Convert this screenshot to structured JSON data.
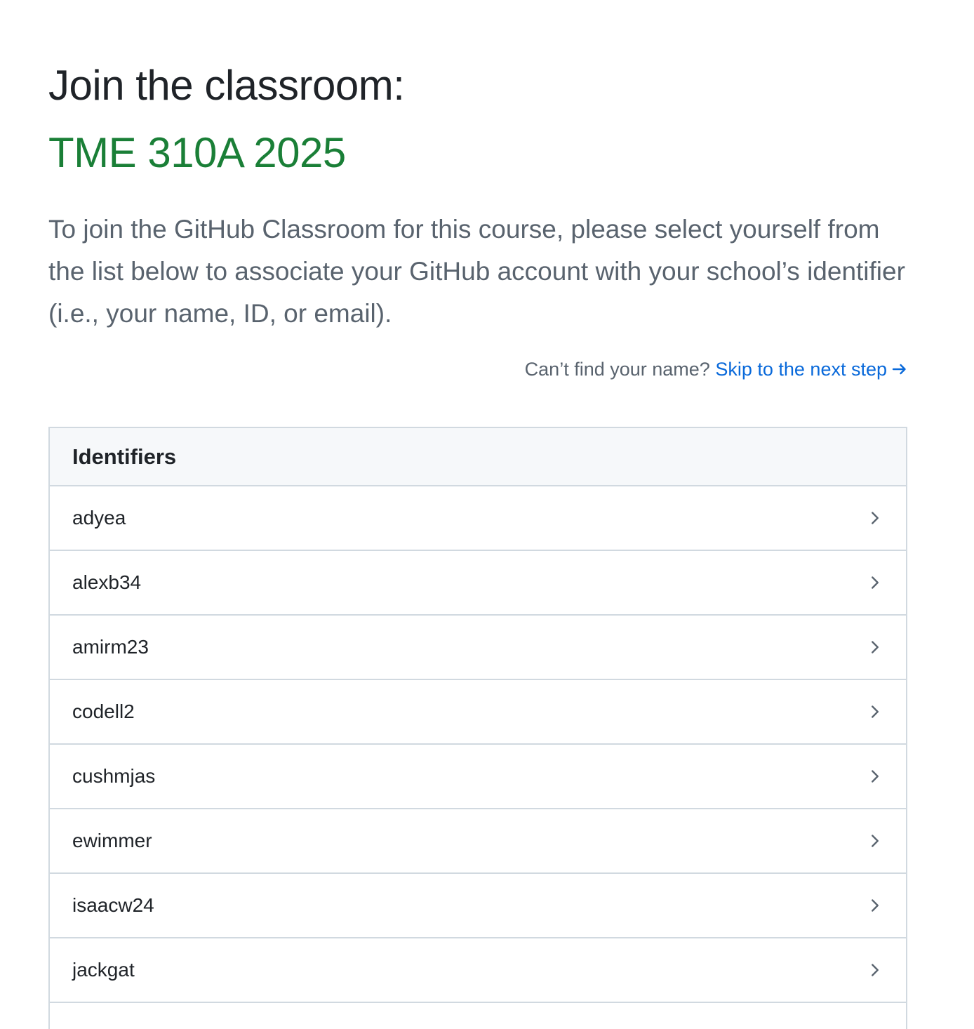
{
  "heading": "Join the classroom:",
  "classroom_name": "TME 310A 2025",
  "intro": "To join the GitHub Classroom for this course, please select yourself from the list below to associate your GitHub account with your school’s identifier (i.e., your name, ID, or email).",
  "skip": {
    "prompt": "Can’t find your name?",
    "link_label": "Skip to the next step",
    "icon": "arrow-right-icon"
  },
  "identifiers": {
    "header": "Identifiers",
    "items": [
      {
        "label": "adyea",
        "icon": "chevron-right-icon"
      },
      {
        "label": "alexb34",
        "icon": "chevron-right-icon"
      },
      {
        "label": "amirm23",
        "icon": "chevron-right-icon"
      },
      {
        "label": "codell2",
        "icon": "chevron-right-icon"
      },
      {
        "label": "cushmjas",
        "icon": "chevron-right-icon"
      },
      {
        "label": "ewimmer",
        "icon": "chevron-right-icon"
      },
      {
        "label": "isaacw24",
        "icon": "chevron-right-icon"
      },
      {
        "label": "jackgat",
        "icon": "chevron-right-icon"
      }
    ]
  },
  "colors": {
    "heading": "#1f2328",
    "classroom_name": "#1a7f37",
    "muted_text": "#59636e",
    "link": "#0969da",
    "border": "#d1d9e0",
    "header_bg": "#f6f8fa"
  }
}
